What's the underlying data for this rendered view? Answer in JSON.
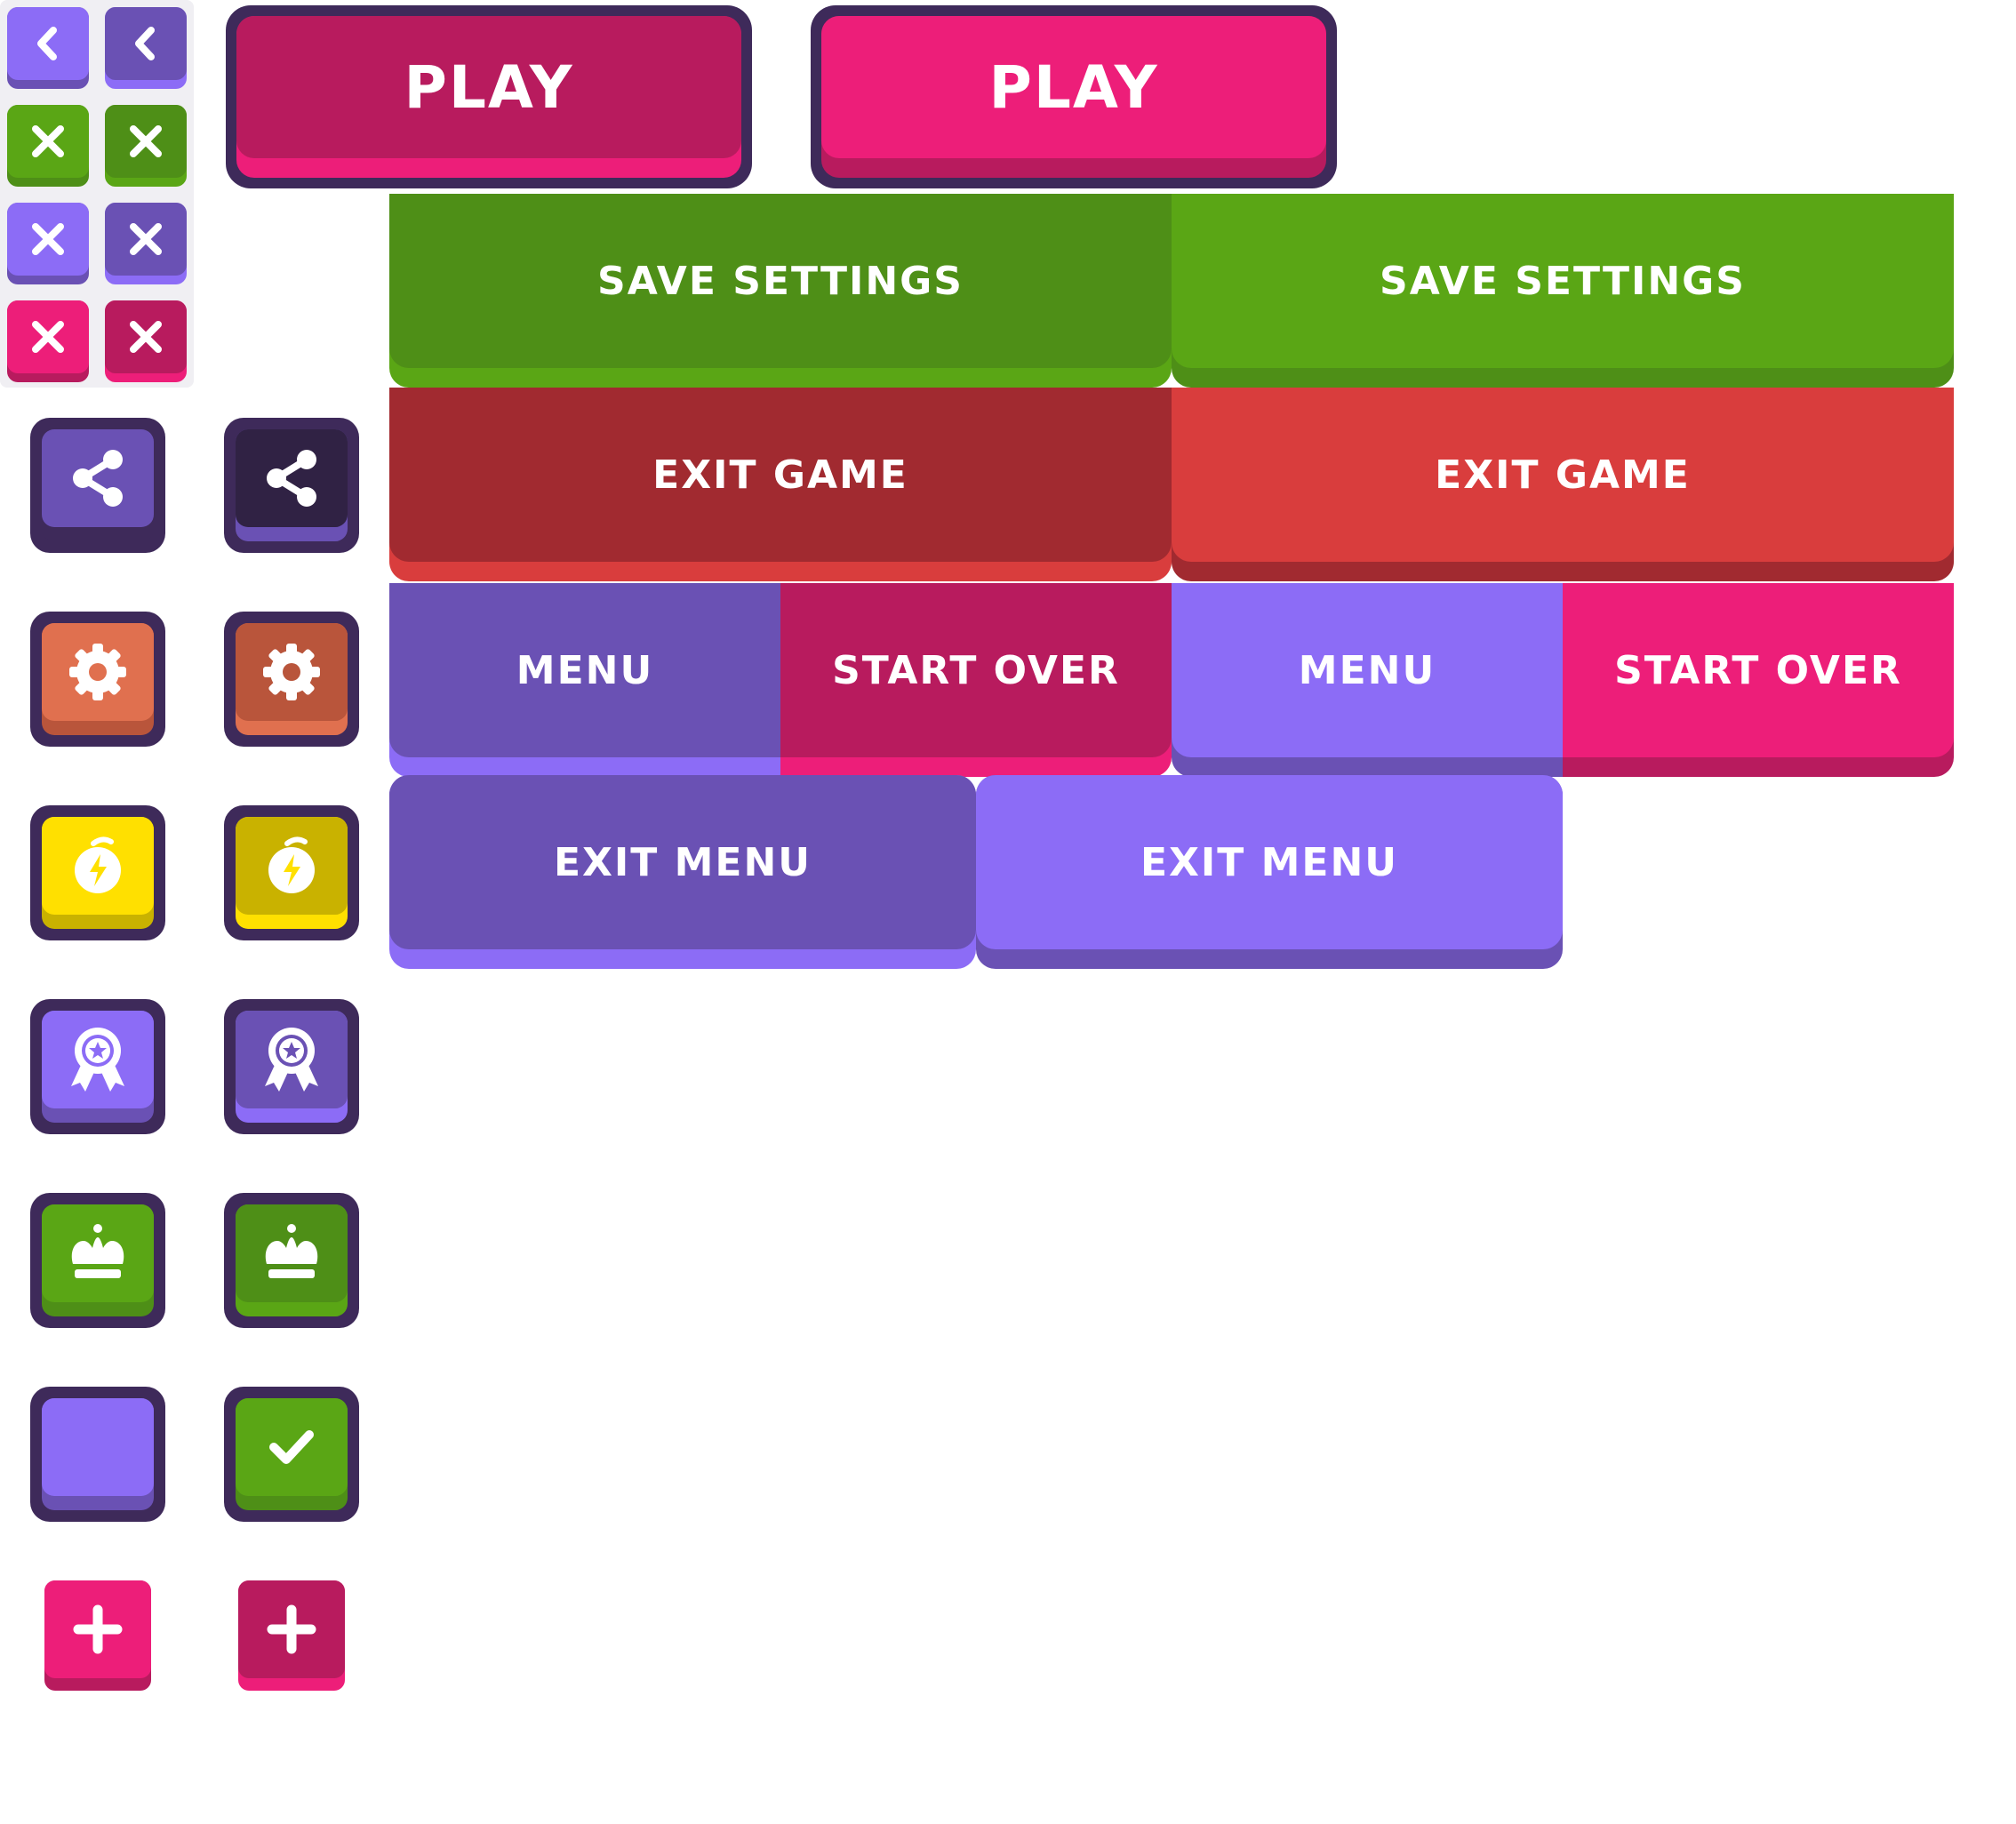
{
  "colors": {
    "dark_outline": "#3e2a5a",
    "violet": "#8c6cf6",
    "violet_dark": "#6a51b4",
    "green": "#5aa615",
    "green_dark": "#4e8f17",
    "pink": "#ed1e79",
    "pink_dark": "#b81b5e",
    "red": "#d93d3d",
    "red_dark": "#a12a30",
    "orange": "#e0704f",
    "orange_dark": "#b9553b",
    "yellow": "#ffe000",
    "yellow_dark": "#c9b200"
  },
  "small_tiles": [
    {
      "icon": "chevron-left-icon",
      "color": "violet"
    },
    {
      "icon": "chevron-left-icon",
      "color": "violet_dark"
    },
    {
      "icon": "close-icon",
      "color": "green"
    },
    {
      "icon": "close-icon",
      "color": "green_dark"
    },
    {
      "icon": "close-icon",
      "color": "violet"
    },
    {
      "icon": "close-icon",
      "color": "violet_dark"
    },
    {
      "icon": "close-icon",
      "color": "pink"
    },
    {
      "icon": "close-icon",
      "color": "pink_dark"
    }
  ],
  "icon_buttons": [
    {
      "icon": "share-icon",
      "variants": [
        "violet_dark",
        "dark"
      ]
    },
    {
      "icon": "gear-icon",
      "variants": [
        "orange",
        "orange_dark"
      ]
    },
    {
      "icon": "stopwatch-icon",
      "variants": [
        "yellow",
        "yellow_dark"
      ]
    },
    {
      "icon": "award-ribbon-icon",
      "variants": [
        "violet",
        "violet_dark"
      ]
    },
    {
      "icon": "crown-icon",
      "variants": [
        "green",
        "green_dark"
      ]
    },
    {
      "icon": "checkbox-icon",
      "variants": [
        "violet-empty",
        "green-checked"
      ]
    },
    {
      "icon": "plus-icon",
      "variants": [
        "pink",
        "pink_dark"
      ]
    }
  ],
  "buttons": {
    "play_left": "PLAY",
    "play_right": "PLAY",
    "save_left": "SAVE SETTINGS",
    "save_right": "SAVE SETTINGS",
    "exit_game_left": "EXIT GAME",
    "exit_game_right": "EXIT GAME",
    "menu_left": "MENU",
    "start_over_left": "START OVER",
    "menu_right": "MENU",
    "start_over_right": "START OVER",
    "exit_menu_left": "EXIT MENU",
    "exit_menu_right": "EXIT MENU"
  }
}
